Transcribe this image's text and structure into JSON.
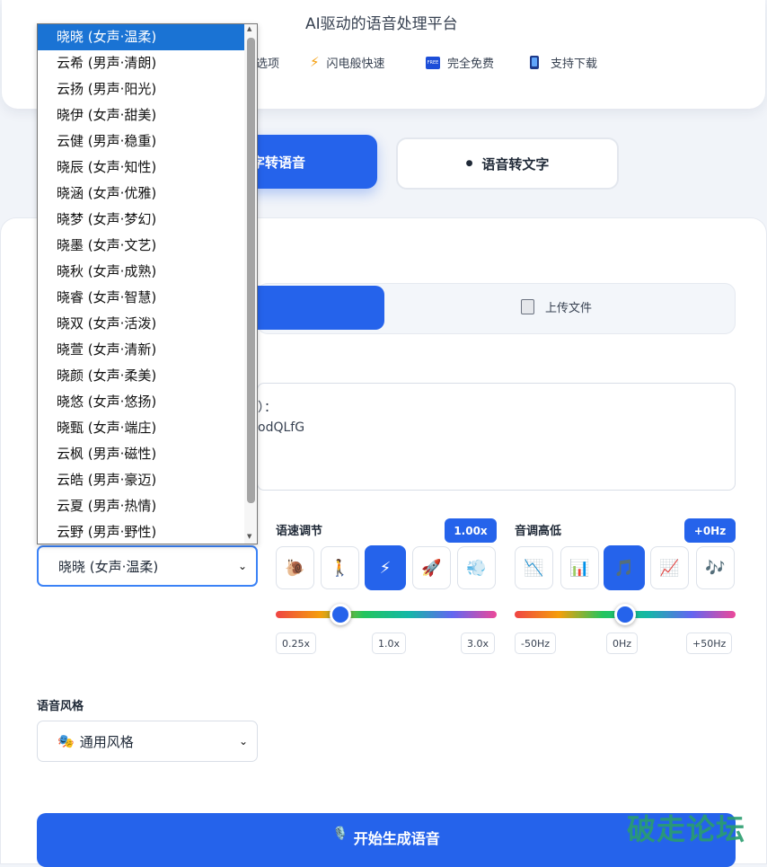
{
  "header": {
    "title": "AI驱动的语音处理平台",
    "features": [
      {
        "icon": "options-icon",
        "label": "选项"
      },
      {
        "icon": "lightning-icon",
        "label": "闪电般快速"
      },
      {
        "icon": "free-icon",
        "label": "完全免费",
        "badge": "FREE"
      },
      {
        "icon": "phone-icon",
        "label": "支持下载"
      }
    ]
  },
  "mode_tabs": {
    "text_to_speech": "字转语音",
    "speech_to_text": "语音转文字"
  },
  "input_tabs": {
    "upload": "上传文件"
  },
  "textarea": {
    "line1": "）：",
    "line2": "odQLfG"
  },
  "speed": {
    "label": "语速调节",
    "value": "1.00x",
    "presets": [
      "🐌",
      "🚶",
      "⚡",
      "🚀",
      "💨"
    ],
    "active_index": 2,
    "level": 0.3,
    "ticks": [
      "0.25x",
      "1.0x",
      "3.0x"
    ]
  },
  "pitch": {
    "label": "音调高低",
    "value": "+0Hz",
    "presets": [
      "📉",
      "📊",
      "🎵",
      "📈",
      "🎶"
    ],
    "active_index": 2,
    "level": 0.5,
    "ticks": [
      "-50Hz",
      "0Hz",
      "+50Hz"
    ]
  },
  "voice": {
    "selected": "晓晓 (女声·温柔)",
    "options": [
      "晓晓 (女声·温柔)",
      "云希 (男声·清朗)",
      "云扬 (男声·阳光)",
      "晓伊 (女声·甜美)",
      "云健 (男声·稳重)",
      "晓辰 (女声·知性)",
      "晓涵 (女声·优雅)",
      "晓梦 (女声·梦幻)",
      "晓墨 (女声·文艺)",
      "晓秋 (女声·成熟)",
      "晓睿 (女声·智慧)",
      "晓双 (女声·活泼)",
      "晓萱 (女声·清新)",
      "晓颜 (女声·柔美)",
      "晓悠 (女声·悠扬)",
      "晓甄 (女声·端庄)",
      "云枫 (男声·磁性)",
      "云皓 (男声·豪迈)",
      "云夏 (男声·热情)",
      "云野 (男声·野性)"
    ]
  },
  "style": {
    "label": "语音风格",
    "icon": "🎭",
    "selected": "通用风格"
  },
  "generate": {
    "icon": "🎙️",
    "label": "开始生成语音"
  },
  "watermark": "破走论坛",
  "colors": {
    "primary": "#2563eb",
    "selected_option": "#1a73d4",
    "watermark": "#2a9d6e"
  }
}
